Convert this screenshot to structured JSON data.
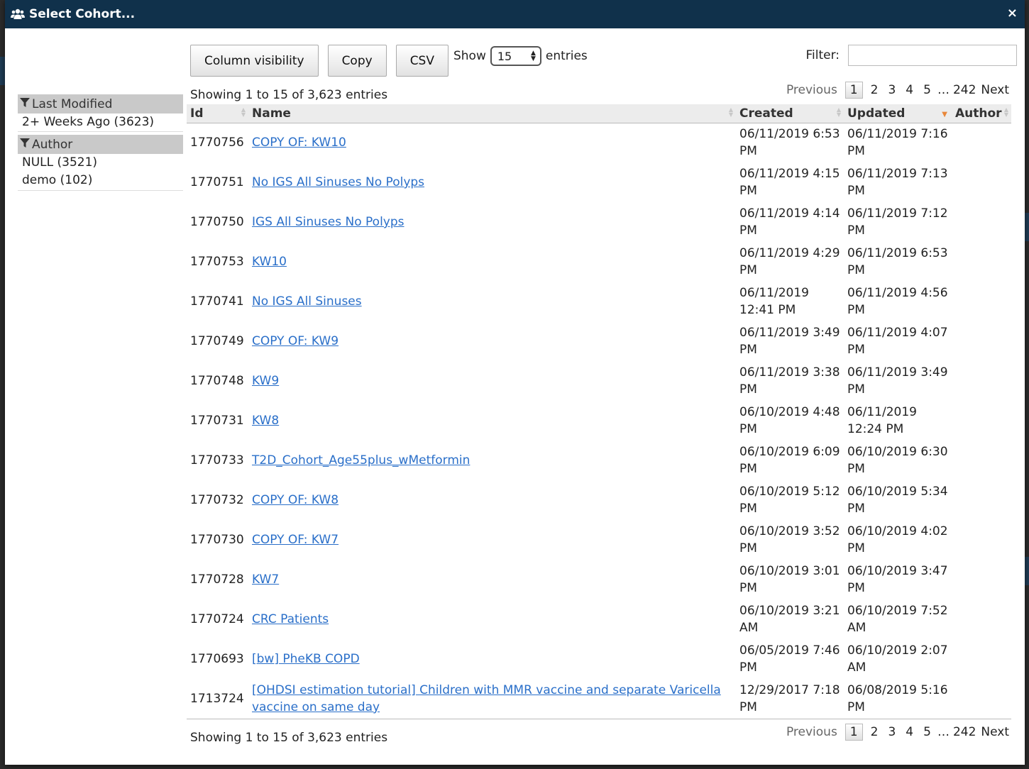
{
  "modal": {
    "title": "Select Cohort...",
    "close_label": "×"
  },
  "toolbar": {
    "column_visibility_label": "Column visibility",
    "copy_label": "Copy",
    "csv_label": "CSV",
    "show_label": "Show",
    "page_size": "15",
    "entries_label": "entries",
    "filter_label": "Filter:",
    "filter_value": ""
  },
  "info": {
    "top": "Showing 1 to 15 of 3,623 entries",
    "bottom": "Showing 1 to 15 of 3,623 entries"
  },
  "pager": {
    "previous": "Previous",
    "pages": [
      "1",
      "2",
      "3",
      "4",
      "5"
    ],
    "ellipsis": "…",
    "last": "242",
    "next": "Next",
    "current": "1"
  },
  "sidebar": {
    "facets": [
      {
        "title": "Last Modified",
        "items": [
          "2+ Weeks Ago (3623)"
        ]
      },
      {
        "title": "Author",
        "items": [
          "NULL (3521)",
          "demo (102)"
        ]
      }
    ]
  },
  "table": {
    "columns": [
      "Id",
      "Name",
      "Created",
      "Updated",
      "Author"
    ],
    "sorted_column": "Updated",
    "rows": [
      {
        "id": "1770756",
        "name": "COPY OF: KW10",
        "created": "06/11/2019 6:53 PM",
        "updated": "06/11/2019 7:16 PM",
        "author": ""
      },
      {
        "id": "1770751",
        "name": "No IGS All Sinuses No Polyps",
        "created": "06/11/2019 4:15 PM",
        "updated": "06/11/2019 7:13 PM",
        "author": ""
      },
      {
        "id": "1770750",
        "name": "IGS All Sinuses No Polyps",
        "created": "06/11/2019 4:14 PM",
        "updated": "06/11/2019 7:12 PM",
        "author": ""
      },
      {
        "id": "1770753",
        "name": "KW10",
        "created": "06/11/2019 4:29 PM",
        "updated": "06/11/2019 6:53 PM",
        "author": ""
      },
      {
        "id": "1770741",
        "name": "No IGS All Sinuses",
        "created": "06/11/2019 12:41 PM",
        "updated": "06/11/2019 4:56 PM",
        "author": ""
      },
      {
        "id": "1770749",
        "name": "COPY OF: KW9",
        "created": "06/11/2019 3:49 PM",
        "updated": "06/11/2019 4:07 PM",
        "author": ""
      },
      {
        "id": "1770748",
        "name": "KW9",
        "created": "06/11/2019 3:38 PM",
        "updated": "06/11/2019 3:49 PM",
        "author": ""
      },
      {
        "id": "1770731",
        "name": "KW8",
        "created": "06/10/2019 4:48 PM",
        "updated": "06/11/2019 12:24 PM",
        "author": ""
      },
      {
        "id": "1770733",
        "name": "T2D_Cohort_Age55plus_wMetformin",
        "created": "06/10/2019 6:09 PM",
        "updated": "06/10/2019 6:30 PM",
        "author": ""
      },
      {
        "id": "1770732",
        "name": "COPY OF: KW8",
        "created": "06/10/2019 5:12 PM",
        "updated": "06/10/2019 5:34 PM",
        "author": ""
      },
      {
        "id": "1770730",
        "name": "COPY OF: KW7",
        "created": "06/10/2019 3:52 PM",
        "updated": "06/10/2019 4:02 PM",
        "author": ""
      },
      {
        "id": "1770728",
        "name": "KW7",
        "created": "06/10/2019 3:01 PM",
        "updated": "06/10/2019 3:47 PM",
        "author": ""
      },
      {
        "id": "1770724",
        "name": "CRC Patients",
        "created": "06/10/2019 3:21 AM",
        "updated": "06/10/2019 7:52 AM",
        "author": ""
      },
      {
        "id": "1770693",
        "name": "[bw] PheKB COPD",
        "created": "06/05/2019 7:46 PM",
        "updated": "06/10/2019 2:07 AM",
        "author": ""
      },
      {
        "id": "1713724",
        "name": "[OHDSI estimation tutorial] Children with MMR vaccine and separate Varicella vaccine on same day",
        "created": "12/29/2017 7:18 PM",
        "updated": "06/08/2019 5:16 PM",
        "author": ""
      }
    ]
  },
  "colors": {
    "header_bg": "#10314b",
    "link": "#2a6fc9",
    "facet_bg": "#c9c9c9",
    "sort_active": "#e8873a"
  }
}
